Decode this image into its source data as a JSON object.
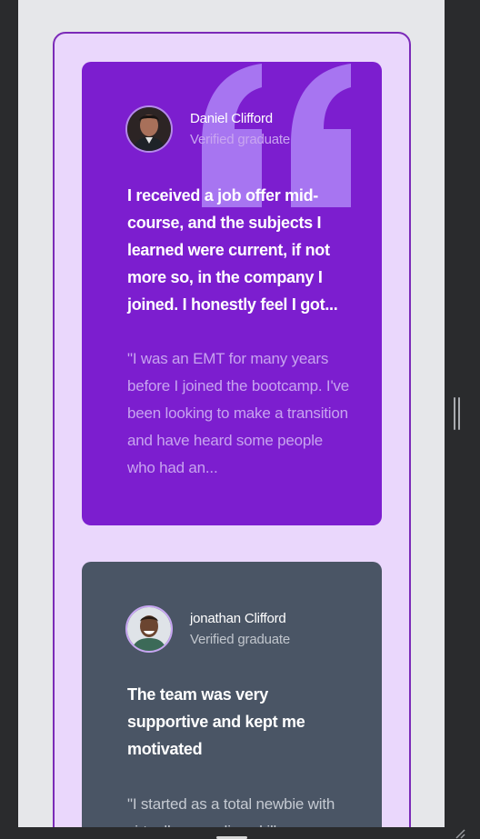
{
  "testimonials": [
    {
      "name": "Daniel Clifford",
      "role": "Verified graduate",
      "headline": "I received a job offer mid-course, and the subjects I learned were current, if not more so, in the company I joined. I honestly feel I got...",
      "quote": "\"I was an EMT for many years before I joined the bootcamp. I've been looking to make a transition and have heard some people who had an...",
      "background": "#7c1ecf"
    },
    {
      "name": "jonathan Clifford",
      "role": "Verified graduate",
      "headline": "The team was very supportive and kept me motivated",
      "quote": "\"I started as a total newbie with virtually no coding skills...",
      "background": "#4a5565"
    }
  ],
  "colors": {
    "page_background": "#e6e7ea",
    "frame_background": "#ead7fc",
    "frame_border": "#7b2ab8",
    "quote_mark": "#a775f1"
  },
  "icons": {
    "quote": "quotation-mark-icon",
    "drag": "drag-handle-icon",
    "resize": "resize-corner-icon"
  }
}
